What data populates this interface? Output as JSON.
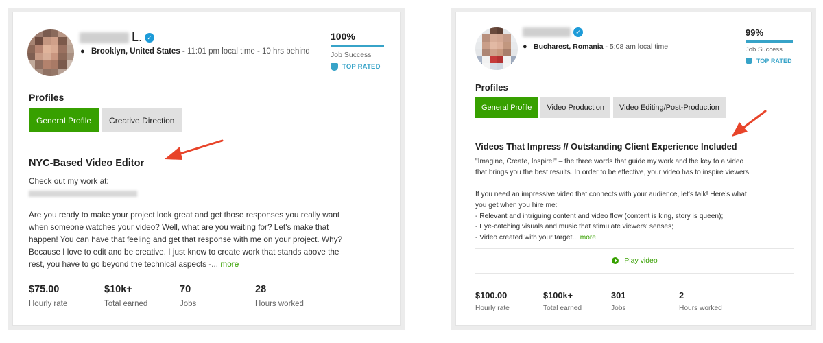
{
  "card1": {
    "name_suffix": "L.",
    "location": "Brooklyn, United States -",
    "local_time": "11:01 pm local time - 10 hrs behind",
    "job_success_pct": "100%",
    "job_success_value": 1.0,
    "job_success_label": "Job Success",
    "top_rated": "TOP RATED",
    "profiles_label": "Profiles",
    "tabs": [
      "General Profile",
      "Creative Direction"
    ],
    "title": "NYC-Based Video Editor",
    "intro": "Check out my work at:",
    "body_lines": [
      "Are you ready to make your project look great and get those responses you really want",
      "when someone watches your video? Well, what are you waiting for? Let's make that",
      "happen! You can have that feeling and get that response with me on your project. Why?",
      "Because I love to edit and be creative. I just know to create work that stands above the",
      "rest, you have to go beyond the technical aspects -..."
    ],
    "more": "more",
    "stats": [
      {
        "value": "$75.00",
        "label": "Hourly rate"
      },
      {
        "value": "$10k+",
        "label": "Total earned"
      },
      {
        "value": "70",
        "label": "Jobs"
      },
      {
        "value": "28",
        "label": "Hours worked"
      }
    ]
  },
  "card2": {
    "location": "Bucharest, Romania -",
    "local_time": "5:08 am local time",
    "job_success_pct": "99%",
    "job_success_value": 0.99,
    "job_success_label": "Job Success",
    "top_rated": "TOP RATED",
    "profiles_label": "Profiles",
    "tabs": [
      "General Profile",
      "Video Production",
      "Video Editing/Post-Production"
    ],
    "title": "Videos That Impress // Outstanding Client Experience Included",
    "body_lines": [
      "\"Imagine, Create, Inspire!\" – the three words that guide my work and the key to a video",
      "that brings you the best results. In order to be effective, your video has to inspire viewers.",
      "",
      "If you need an impressive video that connects with your audience, let's talk! Here's what",
      "you get when you hire me:",
      "- Relevant and intriguing content and video flow (content is king, story is queen);",
      "- Eye-catching visuals and music that stimulate viewers' senses;",
      "- Video created with your target..."
    ],
    "more": "more",
    "play_video": "Play video",
    "stats": [
      {
        "value": "$100.00",
        "label": "Hourly rate"
      },
      {
        "value": "$100k+",
        "label": "Total earned"
      },
      {
        "value": "301",
        "label": "Jobs"
      },
      {
        "value": "2",
        "label": "Hours worked"
      }
    ]
  },
  "colors": {
    "accent_green": "#37a000",
    "accent_blue": "#37a3c8",
    "annotation_arrow": "#e8442a"
  }
}
